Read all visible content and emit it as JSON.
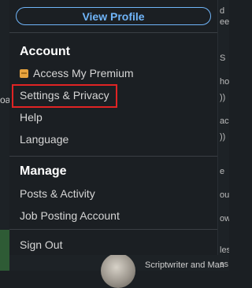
{
  "background": {
    "left_snippet": "oa",
    "right_snippets": [
      "d",
      "ee",
      "S",
      "ho",
      "))",
      "ac",
      "e",
      "ou",
      "ow",
      "les",
      "ss"
    ],
    "bottom_snippet": "Scriptwriter and Man"
  },
  "menu": {
    "view_profile_label": "View Profile",
    "account": {
      "title": "Account",
      "items": [
        "Access My Premium",
        "Settings & Privacy",
        "Help",
        "Language"
      ]
    },
    "manage": {
      "title": "Manage",
      "items": [
        "Posts & Activity",
        "Job Posting Account"
      ]
    },
    "sign_out_label": "Sign Out"
  },
  "highlighted_item": "Settings & Privacy",
  "colors": {
    "accent": "#70b5f9",
    "highlight": "#e02424",
    "premium": "#e7a33e",
    "background": "#1b1f23"
  }
}
